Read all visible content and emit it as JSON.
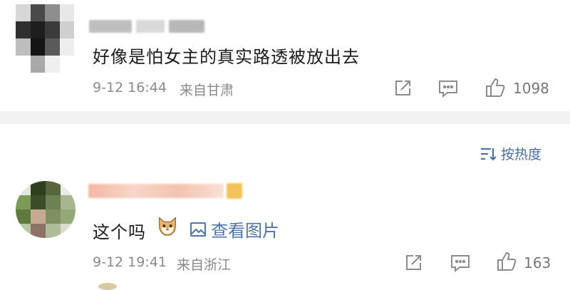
{
  "comments": [
    {
      "text": "好像是怕女主的真实路透被放出去",
      "time": "9-12 16:44",
      "location": "来自甘肃",
      "likes": "1098"
    },
    {
      "text": "这个吗",
      "image_link": "查看图片",
      "time": "9-12 19:41",
      "location": "来自浙江",
      "likes": "163"
    }
  ],
  "sort": {
    "label": "按热度"
  },
  "icons": {
    "share": "share-icon",
    "comment": "comment-icon",
    "like": "thumbs-up-icon",
    "sort": "sort-icon",
    "image": "image-icon",
    "emoji": "cat-emoji-icon"
  },
  "colors": {
    "link": "#4f74a8",
    "meta": "#8a8a8a",
    "divider": "#f2f2f2"
  }
}
